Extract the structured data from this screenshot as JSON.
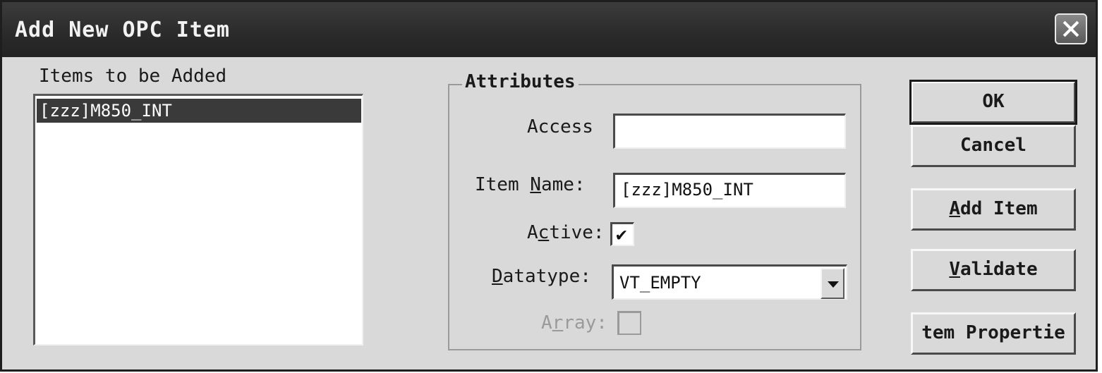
{
  "window": {
    "title": "Add New OPC Item"
  },
  "items_panel": {
    "label": "Items to be Added",
    "items": [
      "[zzz]M850_INT"
    ]
  },
  "attributes": {
    "group_title": "Attributes",
    "access": {
      "label": "Access",
      "value": ""
    },
    "item_name": {
      "label_prefix": "Item ",
      "label_underline": "N",
      "label_suffix": "ame:",
      "value": "[zzz]M850_INT"
    },
    "active": {
      "label_prefix": "A",
      "label_underline": "c",
      "label_suffix": "tive:",
      "checked": true
    },
    "datatype": {
      "label_underline": "D",
      "label_suffix": "atatype:",
      "value": "VT_EMPTY"
    },
    "array": {
      "label_prefix": "A",
      "label_underline": "r",
      "label_suffix": "ray:",
      "checked": false,
      "disabled": true
    }
  },
  "buttons": {
    "ok": "OK",
    "cancel": "Cancel",
    "add_item_underline": "A",
    "add_item_rest": "dd Item",
    "validate_underline": "V",
    "validate_rest": "alidate",
    "item_properties": "tem Propertie"
  },
  "icons": {
    "close": "close-icon",
    "dropdown": "chevron-down-icon",
    "check": "checkmark-icon"
  }
}
